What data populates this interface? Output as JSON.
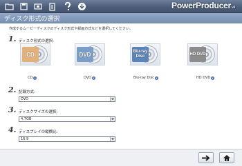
{
  "toolbar": {
    "icons": [
      "folder-icon",
      "save-icon",
      "tools-icon",
      "bookmark-icon",
      "help-icon",
      "info-icon"
    ],
    "brand": "PowerProducer",
    "version": "v4"
  },
  "title": "ディスク形式の選択",
  "instruction": "作成するムービーディスクのディスク形式や録画方式などを選択してください。",
  "steps": [
    {
      "num": "1.",
      "label": "ディスク形式の選択:"
    },
    {
      "num": "2.",
      "label": "記録方式:"
    },
    {
      "num": "3.",
      "label": "ディスクサイズの選択:"
    },
    {
      "num": "4.",
      "label": "ディスプレイの縦横比:"
    }
  ],
  "discs": [
    {
      "name": "CD",
      "art": "CD"
    },
    {
      "name": "DVD",
      "art": "DVD"
    },
    {
      "name": "Blu-ray Disc",
      "art": "Blu-ray Disc"
    },
    {
      "name": "HD DVD",
      "art": "HD DVD"
    }
  ],
  "fields": {
    "recording_format": "DVD",
    "disc_size": "4.7GB",
    "aspect_ratio": "16:9"
  },
  "footer": {
    "next_icon": "arrow-right-icon",
    "home_icon": "home-icon"
  }
}
